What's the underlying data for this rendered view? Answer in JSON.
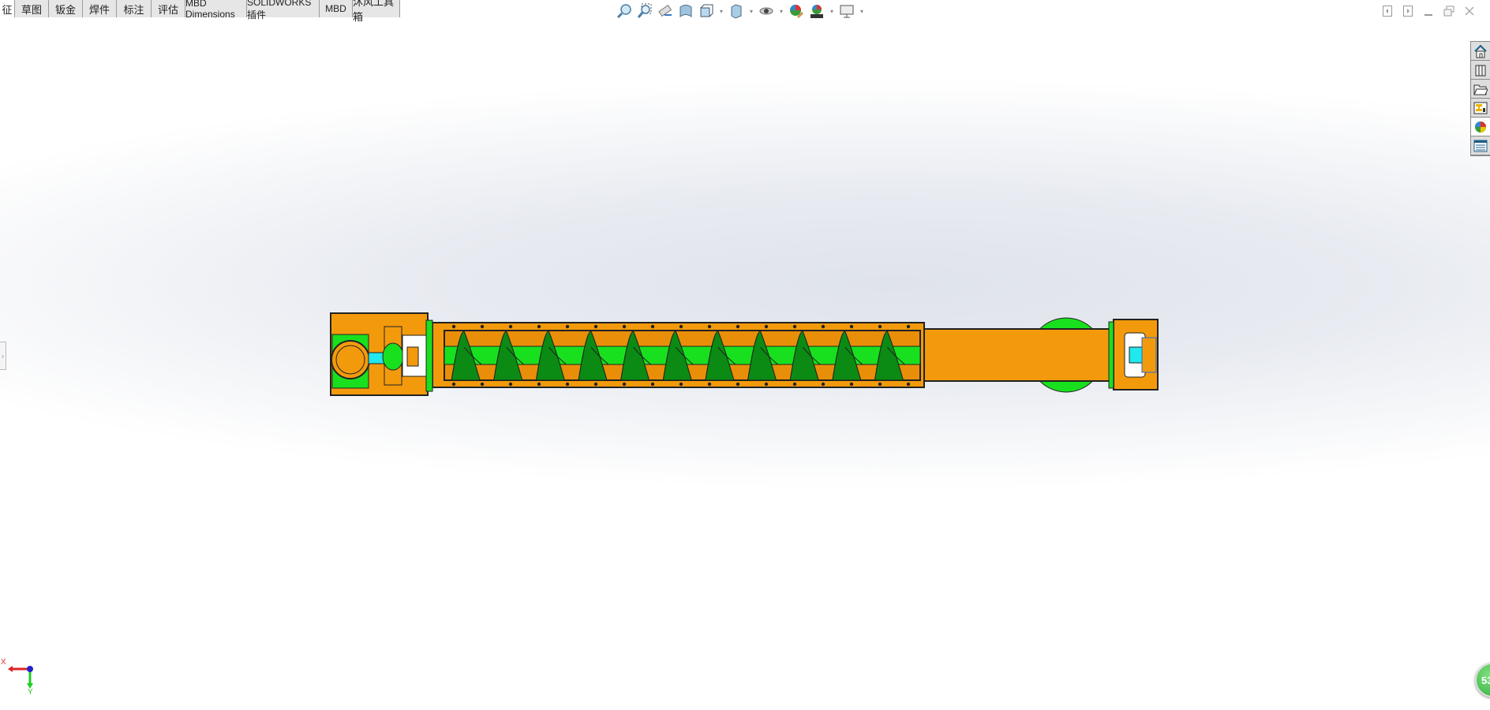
{
  "tabs": [
    "征",
    "草图",
    "钣金",
    "焊件",
    "标注",
    "评估",
    "MBD Dimensions",
    "SOLIDWORKS 插件",
    "MBD",
    "沐风工具箱"
  ],
  "toolbar": {
    "icons": [
      "zoom-to-fit-icon",
      "zoom-to-area-icon",
      "previous-view-icon",
      "section-view-icon",
      "view-orientation-icon",
      "display-style-icon",
      "hide-show-items-icon",
      "edit-appearance-icon",
      "apply-scene-icon",
      "view-settings-icon"
    ]
  },
  "taskpane": {
    "icons": [
      "solidworks-resources-icon",
      "design-library-icon",
      "file-explorer-icon",
      "view-palette-icon",
      "appearances-scenes-icon",
      "custom-properties-icon"
    ]
  },
  "triad": {
    "x_label": "X",
    "y_label": "Y"
  },
  "badge": {
    "value": "53"
  },
  "model": {
    "flight_count": 11,
    "colors": {
      "housing": "#f39a0c",
      "screw": "#19e01e",
      "flight": "#0b8a14",
      "coupling": "#20e8ec",
      "outline": "#1a1a1a"
    }
  }
}
